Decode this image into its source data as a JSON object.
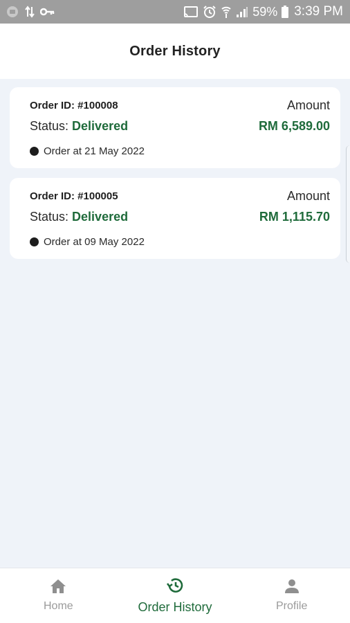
{
  "status_bar": {
    "battery": "59%",
    "time": "3:39 PM",
    "icons": [
      "sim-icon",
      "data-arrows-icon",
      "key-icon",
      "cast-icon",
      "alarm-icon",
      "wifi-icon",
      "signal-icon",
      "battery-icon"
    ]
  },
  "header": {
    "title": "Order History"
  },
  "orders": [
    {
      "order_id": "Order ID: #100008",
      "amount_label": "Amount",
      "status_label": "Status:",
      "status_value": "Delivered",
      "amount_value": "RM 6,589.00",
      "date": "Order at 21 May 2022"
    },
    {
      "order_id": "Order ID: #100005",
      "amount_label": "Amount",
      "status_label": "Status:",
      "status_value": "Delivered",
      "amount_value": "RM 1,115.70",
      "date": "Order at 09 May 2022"
    }
  ],
  "bottom_nav": {
    "items": [
      {
        "label": "Home",
        "icon": "home-icon",
        "active": false
      },
      {
        "label": "Order History",
        "icon": "history-icon",
        "active": true
      },
      {
        "label": "Profile",
        "icon": "person-icon",
        "active": false
      }
    ]
  },
  "colors": {
    "accent": "#1f6b3b",
    "background": "#eff3f9",
    "status_bar": "#9e9e9e"
  }
}
